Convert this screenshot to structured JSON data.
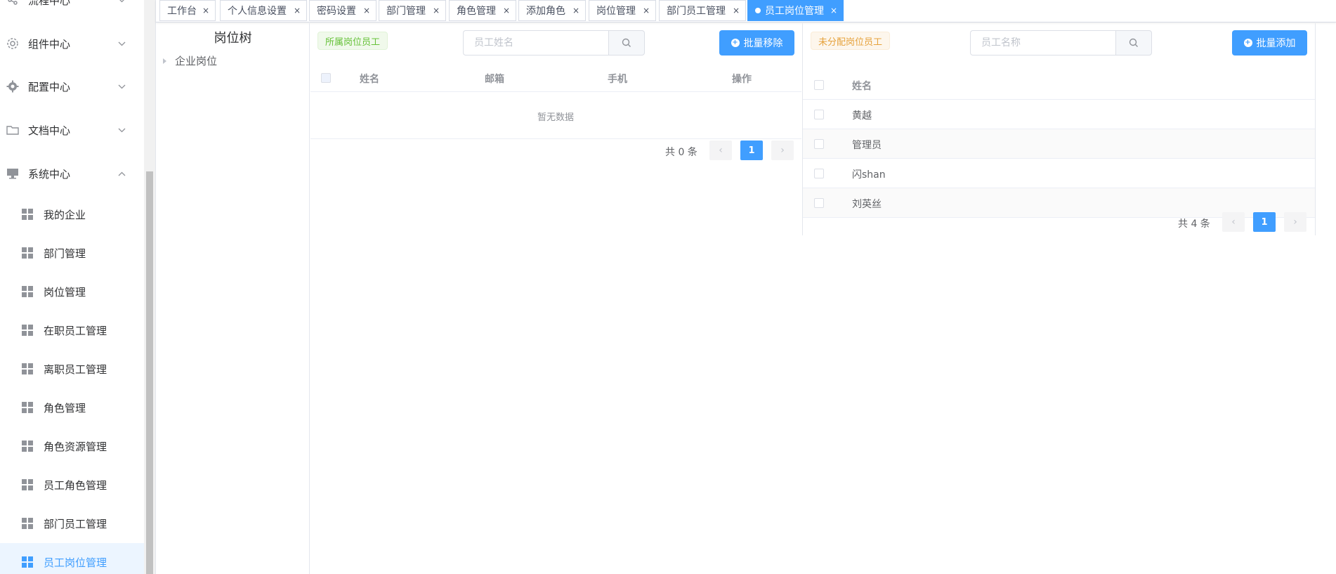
{
  "sidebar": {
    "groups": [
      {
        "label": "流程中心",
        "icon": "share-icon",
        "expanded": false
      },
      {
        "label": "组件中心",
        "icon": "gear-outline-icon",
        "expanded": false
      },
      {
        "label": "配置中心",
        "icon": "cog-icon",
        "expanded": false
      },
      {
        "label": "文档中心",
        "icon": "folder-icon",
        "expanded": false
      },
      {
        "label": "系统中心",
        "icon": "monitor-icon",
        "expanded": true
      }
    ],
    "items": [
      {
        "label": "我的企业"
      },
      {
        "label": "部门管理"
      },
      {
        "label": "岗位管理"
      },
      {
        "label": "在职员工管理"
      },
      {
        "label": "离职员工管理"
      },
      {
        "label": "角色管理"
      },
      {
        "label": "角色资源管理"
      },
      {
        "label": "员工角色管理"
      },
      {
        "label": "部门员工管理"
      },
      {
        "label": "员工岗位管理",
        "active": true
      }
    ]
  },
  "tabs": [
    {
      "label": "工作台"
    },
    {
      "label": "个人信息设置"
    },
    {
      "label": "密码设置"
    },
    {
      "label": "部门管理"
    },
    {
      "label": "角色管理"
    },
    {
      "label": "添加角色"
    },
    {
      "label": "岗位管理"
    },
    {
      "label": "部门员工管理"
    },
    {
      "label": "员工岗位管理",
      "active": true
    }
  ],
  "tree": {
    "title": "岗位树",
    "root_label": "企业岗位"
  },
  "assigned": {
    "tag": "所属岗位员工",
    "search_placeholder": "员工姓名",
    "action_label": "批量移除",
    "columns": [
      "姓名",
      "邮箱",
      "手机",
      "操作"
    ],
    "empty_text": "暂无数据",
    "total_text": "共 0 条",
    "current_page": "1"
  },
  "unassigned": {
    "tag": "未分配岗位员工",
    "search_placeholder": "员工名称",
    "action_label": "批量添加",
    "columns": [
      "姓名"
    ],
    "rows": [
      "黄越",
      "管理员",
      "闪shan",
      "刘英丝"
    ],
    "total_text": "共 4 条",
    "current_page": "1"
  },
  "colors": {
    "primary": "#409eff",
    "success_tag": "#67c23a",
    "warning_tag": "#e6a23c"
  }
}
